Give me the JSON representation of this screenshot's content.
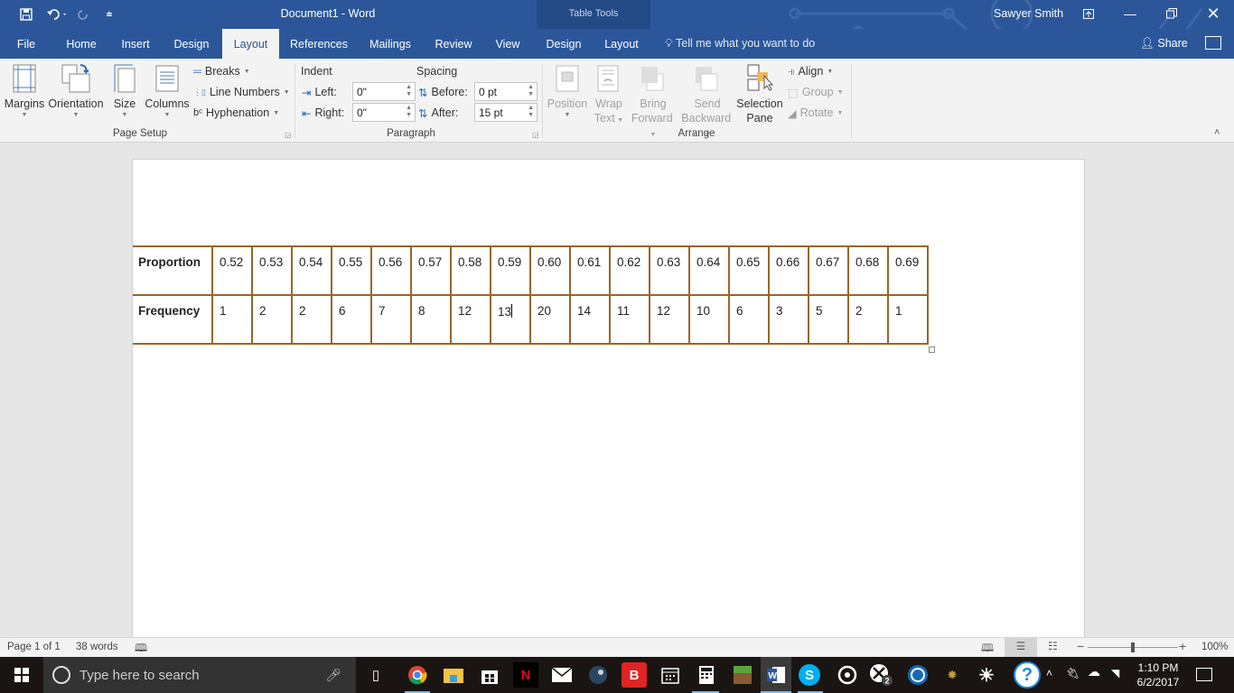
{
  "window": {
    "title": "Document1  -  Word",
    "context_tab_group": "Table Tools",
    "user": "Sawyer Smith"
  },
  "qat": {
    "save": "save-icon",
    "undo": "undo-icon",
    "redo": "redo-icon",
    "customize": "customize-qat-icon"
  },
  "tabs": [
    {
      "label": "File"
    },
    {
      "label": "Home"
    },
    {
      "label": "Insert"
    },
    {
      "label": "Design"
    },
    {
      "label": "Layout",
      "active": true
    },
    {
      "label": "References"
    },
    {
      "label": "Mailings"
    },
    {
      "label": "Review"
    },
    {
      "label": "View"
    },
    {
      "label": "Design"
    },
    {
      "label": "Layout"
    }
  ],
  "tell_me": "Tell me what you want to do",
  "share": "Share",
  "ribbon": {
    "page_setup": {
      "label": "Page Setup",
      "margins": "Margins",
      "orientation": "Orientation",
      "size": "Size",
      "columns": "Columns",
      "breaks": "Breaks",
      "line_numbers": "Line Numbers",
      "hyphenation": "Hyphenation"
    },
    "paragraph": {
      "label": "Paragraph",
      "indent": "Indent",
      "spacing": "Spacing",
      "left_label": "Left:",
      "left_value": "0\"",
      "right_label": "Right:",
      "right_value": "0\"",
      "before_label": "Before:",
      "before_value": "0 pt",
      "after_label": "After:",
      "after_value": "15 pt"
    },
    "arrange": {
      "label": "Arrange",
      "position": "Position",
      "wrap_text_1": "Wrap",
      "wrap_text_2": "Text",
      "bring_forward_1": "Bring",
      "bring_forward_2": "Forward",
      "send_backward_1": "Send",
      "send_backward_2": "Backward",
      "selection_pane_1": "Selection",
      "selection_pane_2": "Pane",
      "align": "Align",
      "group": "Group",
      "rotate": "Rotate"
    }
  },
  "table": {
    "row_headers": [
      "Proportion",
      "Frequency"
    ],
    "proportion": [
      "0.52",
      "0.53",
      "0.54",
      "0.55",
      "0.56",
      "0.57",
      "0.58",
      "0.59",
      "0.60",
      "0.61",
      "0.62",
      "0.63",
      "0.64",
      "0.65",
      "0.66",
      "0.67",
      "0.68",
      "0.69"
    ],
    "frequency": [
      "1",
      "2",
      "2",
      "6",
      "7",
      "8",
      "12",
      "13",
      "20",
      "14",
      "11",
      "12",
      "10",
      "6",
      "3",
      "5",
      "2",
      "1"
    ],
    "border_color": "#9c6528"
  },
  "status": {
    "page": "Page 1 of 1",
    "words": "38 words",
    "zoom": "100%",
    "zoom_level_percent": 100
  },
  "taskbar": {
    "search_placeholder": "Type here to search",
    "time": "1:10 PM",
    "date": "6/2/2017",
    "xbox_badge": "2"
  }
}
